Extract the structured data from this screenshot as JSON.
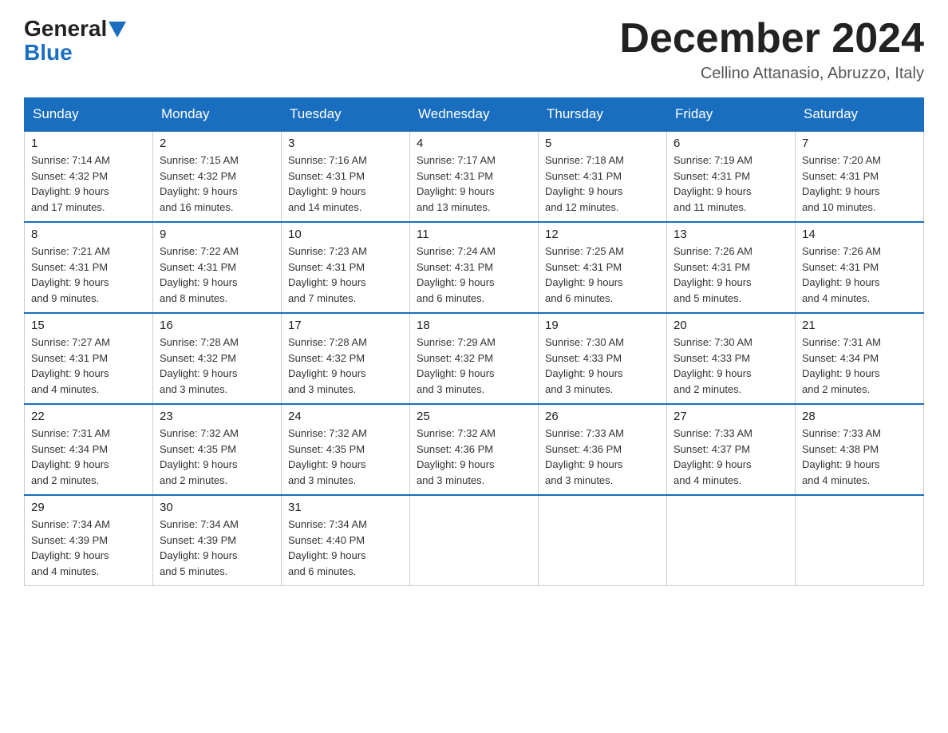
{
  "header": {
    "logo_general": "General",
    "logo_blue": "Blue",
    "month_title": "December 2024",
    "location": "Cellino Attanasio, Abruzzo, Italy"
  },
  "days_of_week": [
    "Sunday",
    "Monday",
    "Tuesday",
    "Wednesday",
    "Thursday",
    "Friday",
    "Saturday"
  ],
  "weeks": [
    [
      {
        "day": "1",
        "sunrise": "7:14 AM",
        "sunset": "4:32 PM",
        "daylight": "9 hours and 17 minutes."
      },
      {
        "day": "2",
        "sunrise": "7:15 AM",
        "sunset": "4:32 PM",
        "daylight": "9 hours and 16 minutes."
      },
      {
        "day": "3",
        "sunrise": "7:16 AM",
        "sunset": "4:31 PM",
        "daylight": "9 hours and 14 minutes."
      },
      {
        "day": "4",
        "sunrise": "7:17 AM",
        "sunset": "4:31 PM",
        "daylight": "9 hours and 13 minutes."
      },
      {
        "day": "5",
        "sunrise": "7:18 AM",
        "sunset": "4:31 PM",
        "daylight": "9 hours and 12 minutes."
      },
      {
        "day": "6",
        "sunrise": "7:19 AM",
        "sunset": "4:31 PM",
        "daylight": "9 hours and 11 minutes."
      },
      {
        "day": "7",
        "sunrise": "7:20 AM",
        "sunset": "4:31 PM",
        "daylight": "9 hours and 10 minutes."
      }
    ],
    [
      {
        "day": "8",
        "sunrise": "7:21 AM",
        "sunset": "4:31 PM",
        "daylight": "9 hours and 9 minutes."
      },
      {
        "day": "9",
        "sunrise": "7:22 AM",
        "sunset": "4:31 PM",
        "daylight": "9 hours and 8 minutes."
      },
      {
        "day": "10",
        "sunrise": "7:23 AM",
        "sunset": "4:31 PM",
        "daylight": "9 hours and 7 minutes."
      },
      {
        "day": "11",
        "sunrise": "7:24 AM",
        "sunset": "4:31 PM",
        "daylight": "9 hours and 6 minutes."
      },
      {
        "day": "12",
        "sunrise": "7:25 AM",
        "sunset": "4:31 PM",
        "daylight": "9 hours and 6 minutes."
      },
      {
        "day": "13",
        "sunrise": "7:26 AM",
        "sunset": "4:31 PM",
        "daylight": "9 hours and 5 minutes."
      },
      {
        "day": "14",
        "sunrise": "7:26 AM",
        "sunset": "4:31 PM",
        "daylight": "9 hours and 4 minutes."
      }
    ],
    [
      {
        "day": "15",
        "sunrise": "7:27 AM",
        "sunset": "4:31 PM",
        "daylight": "9 hours and 4 minutes."
      },
      {
        "day": "16",
        "sunrise": "7:28 AM",
        "sunset": "4:32 PM",
        "daylight": "9 hours and 3 minutes."
      },
      {
        "day": "17",
        "sunrise": "7:28 AM",
        "sunset": "4:32 PM",
        "daylight": "9 hours and 3 minutes."
      },
      {
        "day": "18",
        "sunrise": "7:29 AM",
        "sunset": "4:32 PM",
        "daylight": "9 hours and 3 minutes."
      },
      {
        "day": "19",
        "sunrise": "7:30 AM",
        "sunset": "4:33 PM",
        "daylight": "9 hours and 3 minutes."
      },
      {
        "day": "20",
        "sunrise": "7:30 AM",
        "sunset": "4:33 PM",
        "daylight": "9 hours and 2 minutes."
      },
      {
        "day": "21",
        "sunrise": "7:31 AM",
        "sunset": "4:34 PM",
        "daylight": "9 hours and 2 minutes."
      }
    ],
    [
      {
        "day": "22",
        "sunrise": "7:31 AM",
        "sunset": "4:34 PM",
        "daylight": "9 hours and 2 minutes."
      },
      {
        "day": "23",
        "sunrise": "7:32 AM",
        "sunset": "4:35 PM",
        "daylight": "9 hours and 2 minutes."
      },
      {
        "day": "24",
        "sunrise": "7:32 AM",
        "sunset": "4:35 PM",
        "daylight": "9 hours and 3 minutes."
      },
      {
        "day": "25",
        "sunrise": "7:32 AM",
        "sunset": "4:36 PM",
        "daylight": "9 hours and 3 minutes."
      },
      {
        "day": "26",
        "sunrise": "7:33 AM",
        "sunset": "4:36 PM",
        "daylight": "9 hours and 3 minutes."
      },
      {
        "day": "27",
        "sunrise": "7:33 AM",
        "sunset": "4:37 PM",
        "daylight": "9 hours and 4 minutes."
      },
      {
        "day": "28",
        "sunrise": "7:33 AM",
        "sunset": "4:38 PM",
        "daylight": "9 hours and 4 minutes."
      }
    ],
    [
      {
        "day": "29",
        "sunrise": "7:34 AM",
        "sunset": "4:39 PM",
        "daylight": "9 hours and 4 minutes."
      },
      {
        "day": "30",
        "sunrise": "7:34 AM",
        "sunset": "4:39 PM",
        "daylight": "9 hours and 5 minutes."
      },
      {
        "day": "31",
        "sunrise": "7:34 AM",
        "sunset": "4:40 PM",
        "daylight": "9 hours and 6 minutes."
      },
      null,
      null,
      null,
      null
    ]
  ],
  "labels": {
    "sunrise": "Sunrise:",
    "sunset": "Sunset:",
    "daylight": "Daylight:"
  }
}
